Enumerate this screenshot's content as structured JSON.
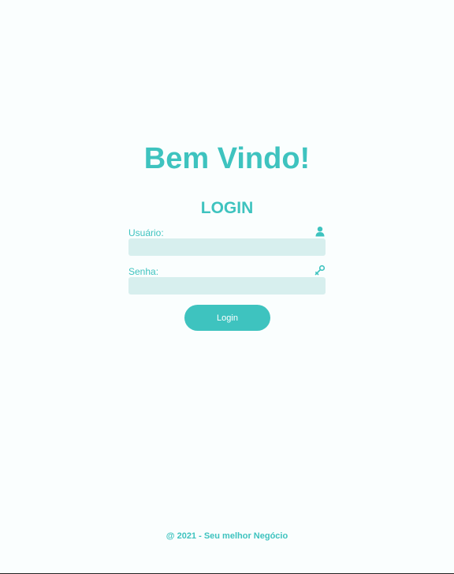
{
  "page": {
    "welcome_title": "Bem Vindo!",
    "login_heading": "LOGIN"
  },
  "form": {
    "user": {
      "label": "Usuário:",
      "value": "",
      "placeholder": "",
      "icon": "user-icon"
    },
    "password": {
      "label": "Senha:",
      "value": "",
      "placeholder": "",
      "icon": "key-icon"
    },
    "submit_label": "Login"
  },
  "footer": {
    "text": "@ 2021 - Seu melhor Negócio"
  },
  "colors": {
    "accent": "#3ec3bf",
    "input_background": "#d7efee",
    "page_background": "#fafefe"
  }
}
